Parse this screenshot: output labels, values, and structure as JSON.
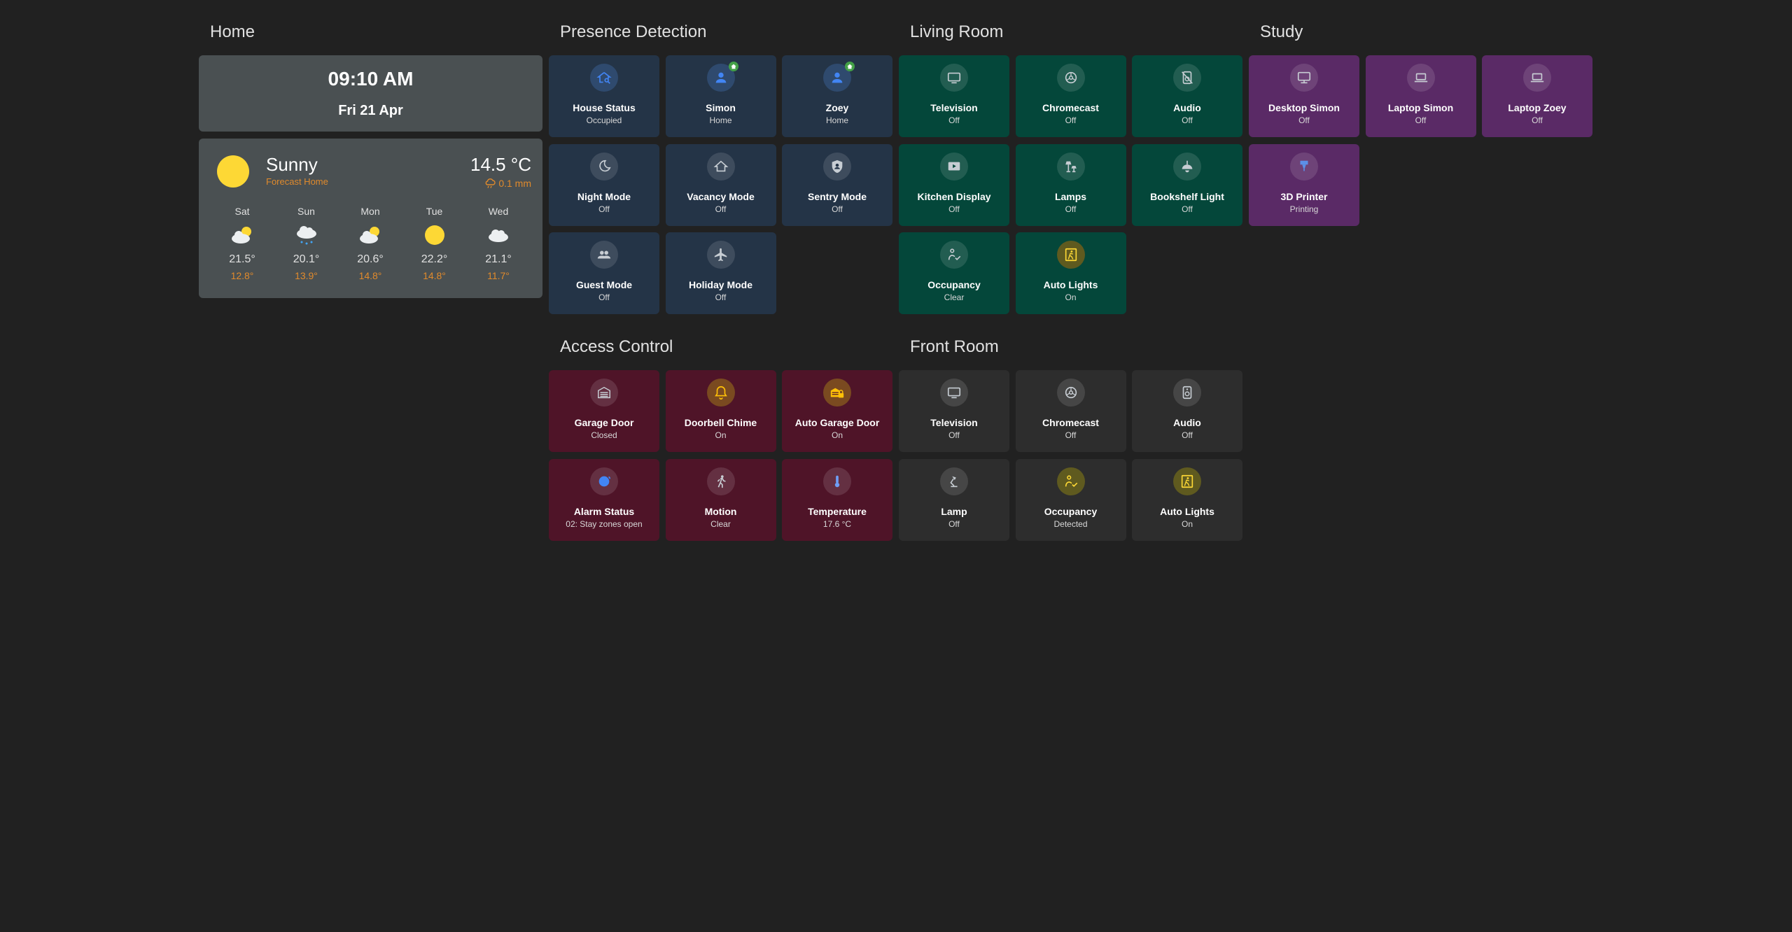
{
  "colors": {
    "background": "#212121",
    "accent_orange": "#e08a2c",
    "sun": "#fdd835",
    "presence_tile": "#243447",
    "living_tile": "#04473a",
    "study_tile": "#5a2a66",
    "access_tile": "#4f1428",
    "front_tile": "#2d2d2d"
  },
  "home": {
    "title": "Home",
    "clock": {
      "time": "09:10 AM",
      "date": "Fri 21 Apr"
    },
    "weather": {
      "state": "Sunny",
      "source": "Forecast Home",
      "temperature": "14.5 °C",
      "precipitation": "0.1 mm",
      "forecast": [
        {
          "day": "Sat",
          "icon": "partly-cloudy-icon",
          "high": "21.5°",
          "low": "12.8°"
        },
        {
          "day": "Sun",
          "icon": "rainy-icon",
          "high": "20.1°",
          "low": "13.9°"
        },
        {
          "day": "Mon",
          "icon": "partly-cloudy-icon",
          "high": "20.6°",
          "low": "14.8°"
        },
        {
          "day": "Tue",
          "icon": "sunny-icon",
          "high": "22.2°",
          "low": "14.8°"
        },
        {
          "day": "Wed",
          "icon": "cloudy-icon",
          "high": "21.1°",
          "low": "11.7°"
        }
      ]
    }
  },
  "presence": {
    "title": "Presence Detection",
    "tiles": [
      {
        "name": "House Status",
        "state": "Occupied",
        "icon": "home-search-icon"
      },
      {
        "name": "Simon",
        "state": "Home",
        "icon": "person-icon"
      },
      {
        "name": "Zoey",
        "state": "Home",
        "icon": "person-icon"
      },
      {
        "name": "Night Mode",
        "state": "Off",
        "icon": "moon-icon"
      },
      {
        "name": "Vacancy Mode",
        "state": "Off",
        "icon": "home-outline-icon"
      },
      {
        "name": "Sentry Mode",
        "state": "Off",
        "icon": "shield-account-icon"
      },
      {
        "name": "Guest Mode",
        "state": "Off",
        "icon": "account-group-icon"
      },
      {
        "name": "Holiday Mode",
        "state": "Off",
        "icon": "airplane-icon"
      }
    ]
  },
  "living": {
    "title": "Living Room",
    "tiles": [
      {
        "name": "Television",
        "state": "Off",
        "icon": "television-icon"
      },
      {
        "name": "Chromecast",
        "state": "Off",
        "icon": "cast-icon"
      },
      {
        "name": "Audio",
        "state": "Off",
        "icon": "speaker-off-icon"
      },
      {
        "name": "Kitchen Display",
        "state": "Off",
        "icon": "display-play-icon"
      },
      {
        "name": "Lamps",
        "state": "Off",
        "icon": "lamps-icon"
      },
      {
        "name": "Bookshelf Light",
        "state": "Off",
        "icon": "ceiling-light-icon"
      },
      {
        "name": "Occupancy",
        "state": "Clear",
        "icon": "motion-sensor-icon"
      },
      {
        "name": "Auto Lights",
        "state": "On",
        "icon": "auto-light-icon"
      }
    ]
  },
  "study": {
    "title": "Study",
    "tiles": [
      {
        "name": "Desktop Simon",
        "state": "Off",
        "icon": "monitor-icon"
      },
      {
        "name": "Laptop Simon",
        "state": "Off",
        "icon": "laptop-icon"
      },
      {
        "name": "Laptop Zoey",
        "state": "Off",
        "icon": "laptop-icon"
      },
      {
        "name": "3D Printer",
        "state": "Printing",
        "icon": "printer-3d-icon"
      }
    ]
  },
  "access": {
    "title": "Access Control",
    "tiles": [
      {
        "name": "Garage Door",
        "state": "Closed",
        "icon": "garage-icon"
      },
      {
        "name": "Doorbell Chime",
        "state": "On",
        "icon": "bell-icon"
      },
      {
        "name": "Auto Garage Door",
        "state": "On",
        "icon": "garage-lock-icon"
      },
      {
        "name": "Alarm Status",
        "state": "02: Stay zones open",
        "icon": "alarm-icon"
      },
      {
        "name": "Motion",
        "state": "Clear",
        "icon": "walk-icon"
      },
      {
        "name": "Temperature",
        "state": "17.6 °C",
        "icon": "thermometer-icon"
      }
    ]
  },
  "front": {
    "title": "Front Room",
    "tiles": [
      {
        "name": "Television",
        "state": "Off",
        "icon": "television-icon"
      },
      {
        "name": "Chromecast",
        "state": "Off",
        "icon": "cast-icon"
      },
      {
        "name": "Audio",
        "state": "Off",
        "icon": "speaker-icon"
      },
      {
        "name": "Lamp",
        "state": "Off",
        "icon": "desk-lamp-icon"
      },
      {
        "name": "Occupancy",
        "state": "Detected",
        "icon": "motion-sensor-icon"
      },
      {
        "name": "Auto Lights",
        "state": "On",
        "icon": "auto-light-icon"
      }
    ]
  }
}
